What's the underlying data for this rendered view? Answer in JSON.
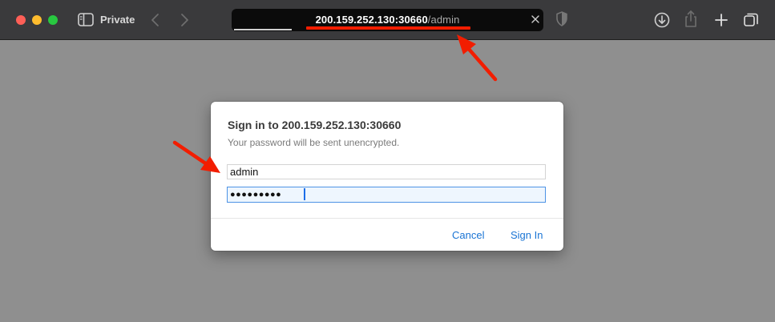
{
  "toolbar": {
    "private_label": "Private",
    "address": {
      "host": "200.159.252.130:30660",
      "path": "/admin"
    }
  },
  "dialog": {
    "title": "Sign in to 200.159.252.130:30660",
    "subtitle": "Your password will be sent unencrypted.",
    "username_value": "admin",
    "password_value": "●●●●●●●●●",
    "cancel_label": "Cancel",
    "signin_label": "Sign In"
  },
  "colors": {
    "toolbar_bg": "#3a3a3c",
    "page_bg": "#8f8f8f",
    "accent_blue": "#1a74d4",
    "annotation_red": "#f21d00"
  },
  "icons": [
    "sidebar-icon",
    "back-icon",
    "forward-icon",
    "clear-icon",
    "shield-icon",
    "download-icon",
    "share-icon",
    "new-tab-icon",
    "tabs-overview-icon",
    "arrow-annotation"
  ]
}
